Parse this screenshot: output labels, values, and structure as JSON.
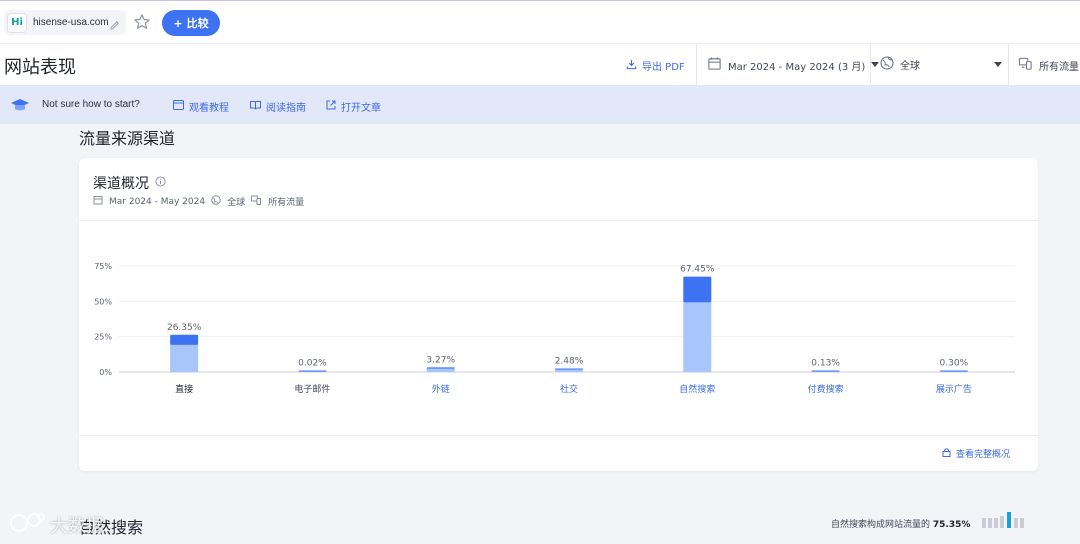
{
  "topbar": {
    "site_logo": "Hi",
    "site_name": "hisense-usa.com",
    "compare_label": "比较",
    "compare_plus": "+"
  },
  "header": {
    "page_title": "网站表现",
    "export_label": "导出 PDF",
    "date_range": "Mar 2024 - May 2024 (3 月)",
    "region": "全球",
    "traffic": "所有流量"
  },
  "banner": {
    "question": "Not sure how to start?",
    "links": [
      "观看教程",
      "阅读指南",
      "打开文章"
    ]
  },
  "section_title": "流量来源渠道",
  "card": {
    "title": "渠道概况",
    "meta_date": "Mar 2024 - May 2024",
    "meta_region": "全球",
    "meta_traffic": "所有流量",
    "footer_link": "查看完整概况"
  },
  "chart_data": {
    "type": "bar",
    "categories": [
      "直接",
      "电子邮件",
      "外链",
      "社交",
      "自然搜索",
      "付费搜索",
      "展示广告"
    ],
    "values": [
      26.35,
      0.02,
      3.27,
      2.48,
      67.45,
      0.13,
      0.3
    ],
    "value_labels": [
      "26.35%",
      "0.02%",
      "3.27%",
      "2.48%",
      "67.45%",
      "0.13%",
      "0.30%"
    ],
    "y_ticks": [
      "0%",
      "25%",
      "50%",
      "75%"
    ],
    "ylim": [
      0,
      75
    ],
    "grid": true,
    "colors": {
      "dark": "#3d73f2",
      "light": "#a9c6fb",
      "label_active": "#1f232c",
      "label_link": "#3d6ae6",
      "label_muted": "#40465a"
    }
  },
  "bottom": {
    "organic_title": "自然搜索",
    "organic_stat_label": "自然搜索构成网站流量的",
    "organic_stat_value": "75.35%",
    "watermark": "大数据"
  }
}
